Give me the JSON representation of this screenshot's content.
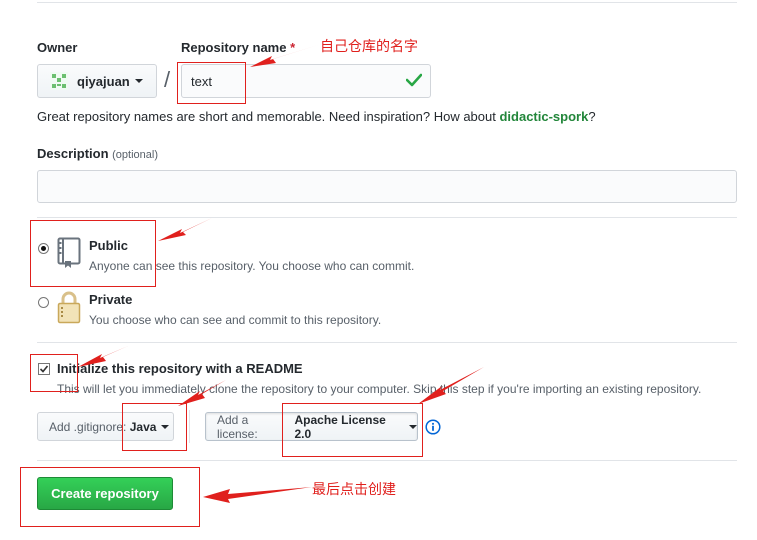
{
  "owner": {
    "label": "Owner",
    "selected": "qiyajuan"
  },
  "repo_name": {
    "label": "Repository name",
    "required_mark": "*",
    "value": "text",
    "slash": "/"
  },
  "name_hint": {
    "text": "Great repository names are short and memorable. Need inspiration? How about ",
    "suggestion": "didactic-spork",
    "end": "?"
  },
  "description": {
    "label": "Description",
    "optional": "(optional)",
    "value": ""
  },
  "visibility": {
    "selected": "public",
    "public": {
      "title": "Public",
      "desc": "Anyone can see this repository. You choose who can commit."
    },
    "private": {
      "title": "Private",
      "desc": "You choose who can see and commit to this repository."
    }
  },
  "readme": {
    "checked": true,
    "label": "Initialize this repository with a README",
    "desc": "This will let you immediately clone the repository to your computer. Skip this step if you're importing an existing repository."
  },
  "gitignore": {
    "prefix": "Add .gitignore:",
    "value": "Java"
  },
  "license": {
    "prefix": "Add a license:",
    "value": "Apache License 2.0"
  },
  "create_button": "Create repository",
  "annotations": {
    "repo_name": "自己仓库的名字",
    "create": "最后点击创建"
  },
  "colors": {
    "accent_green": "#28a745",
    "annotation_red": "#e0201d",
    "link_green": "#22863a",
    "info_blue": "#0366d6"
  }
}
